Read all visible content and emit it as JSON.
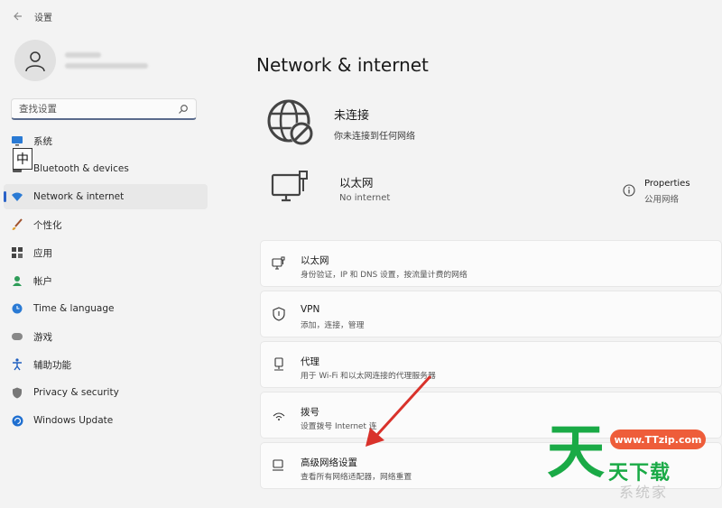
{
  "window": {
    "title": "设置"
  },
  "search": {
    "placeholder": "查找设置"
  },
  "ime": {
    "char": "中"
  },
  "sidebar": {
    "items": [
      {
        "label": "系统"
      },
      {
        "label": "Bluetooth & devices"
      },
      {
        "label": "Network & internet"
      },
      {
        "label": "个性化"
      },
      {
        "label": "应用"
      },
      {
        "label": "帐户"
      },
      {
        "label": "Time & language"
      },
      {
        "label": "游戏"
      },
      {
        "label": "辅助功能"
      },
      {
        "label": "Privacy & security"
      },
      {
        "label": "Windows Update"
      }
    ]
  },
  "main": {
    "title": "Network & internet",
    "status": {
      "title": "未连接",
      "subtitle": "你未连接到任何网络"
    },
    "ethernet": {
      "title": "以太网",
      "subtitle": "No internet"
    },
    "properties": {
      "title": "Properties",
      "subtitle": "公用网络"
    },
    "cards": [
      {
        "title": "以太网",
        "subtitle": "身份验证，IP 和 DNS 设置，按流量计费的网络"
      },
      {
        "title": "VPN",
        "subtitle": "添加，连接，管理"
      },
      {
        "title": "代理",
        "subtitle": "用于 Wi-Fi 和以太网连接的代理服务器"
      },
      {
        "title": "拨号",
        "subtitle": "设置拨号 Internet 连"
      },
      {
        "title": "高级网络设置",
        "subtitle": "查看所有网络适配器，网络重置"
      }
    ]
  },
  "watermark": {
    "url": "www.TTzip.com",
    "brand_big": "天",
    "brand": "天下载",
    "faint": "系统家"
  },
  "colors": {
    "accent": "#2b63c8",
    "arrow": "#d9322b",
    "watermark_green": "#1aaa46",
    "watermark_orange": "#ee5d3a"
  }
}
